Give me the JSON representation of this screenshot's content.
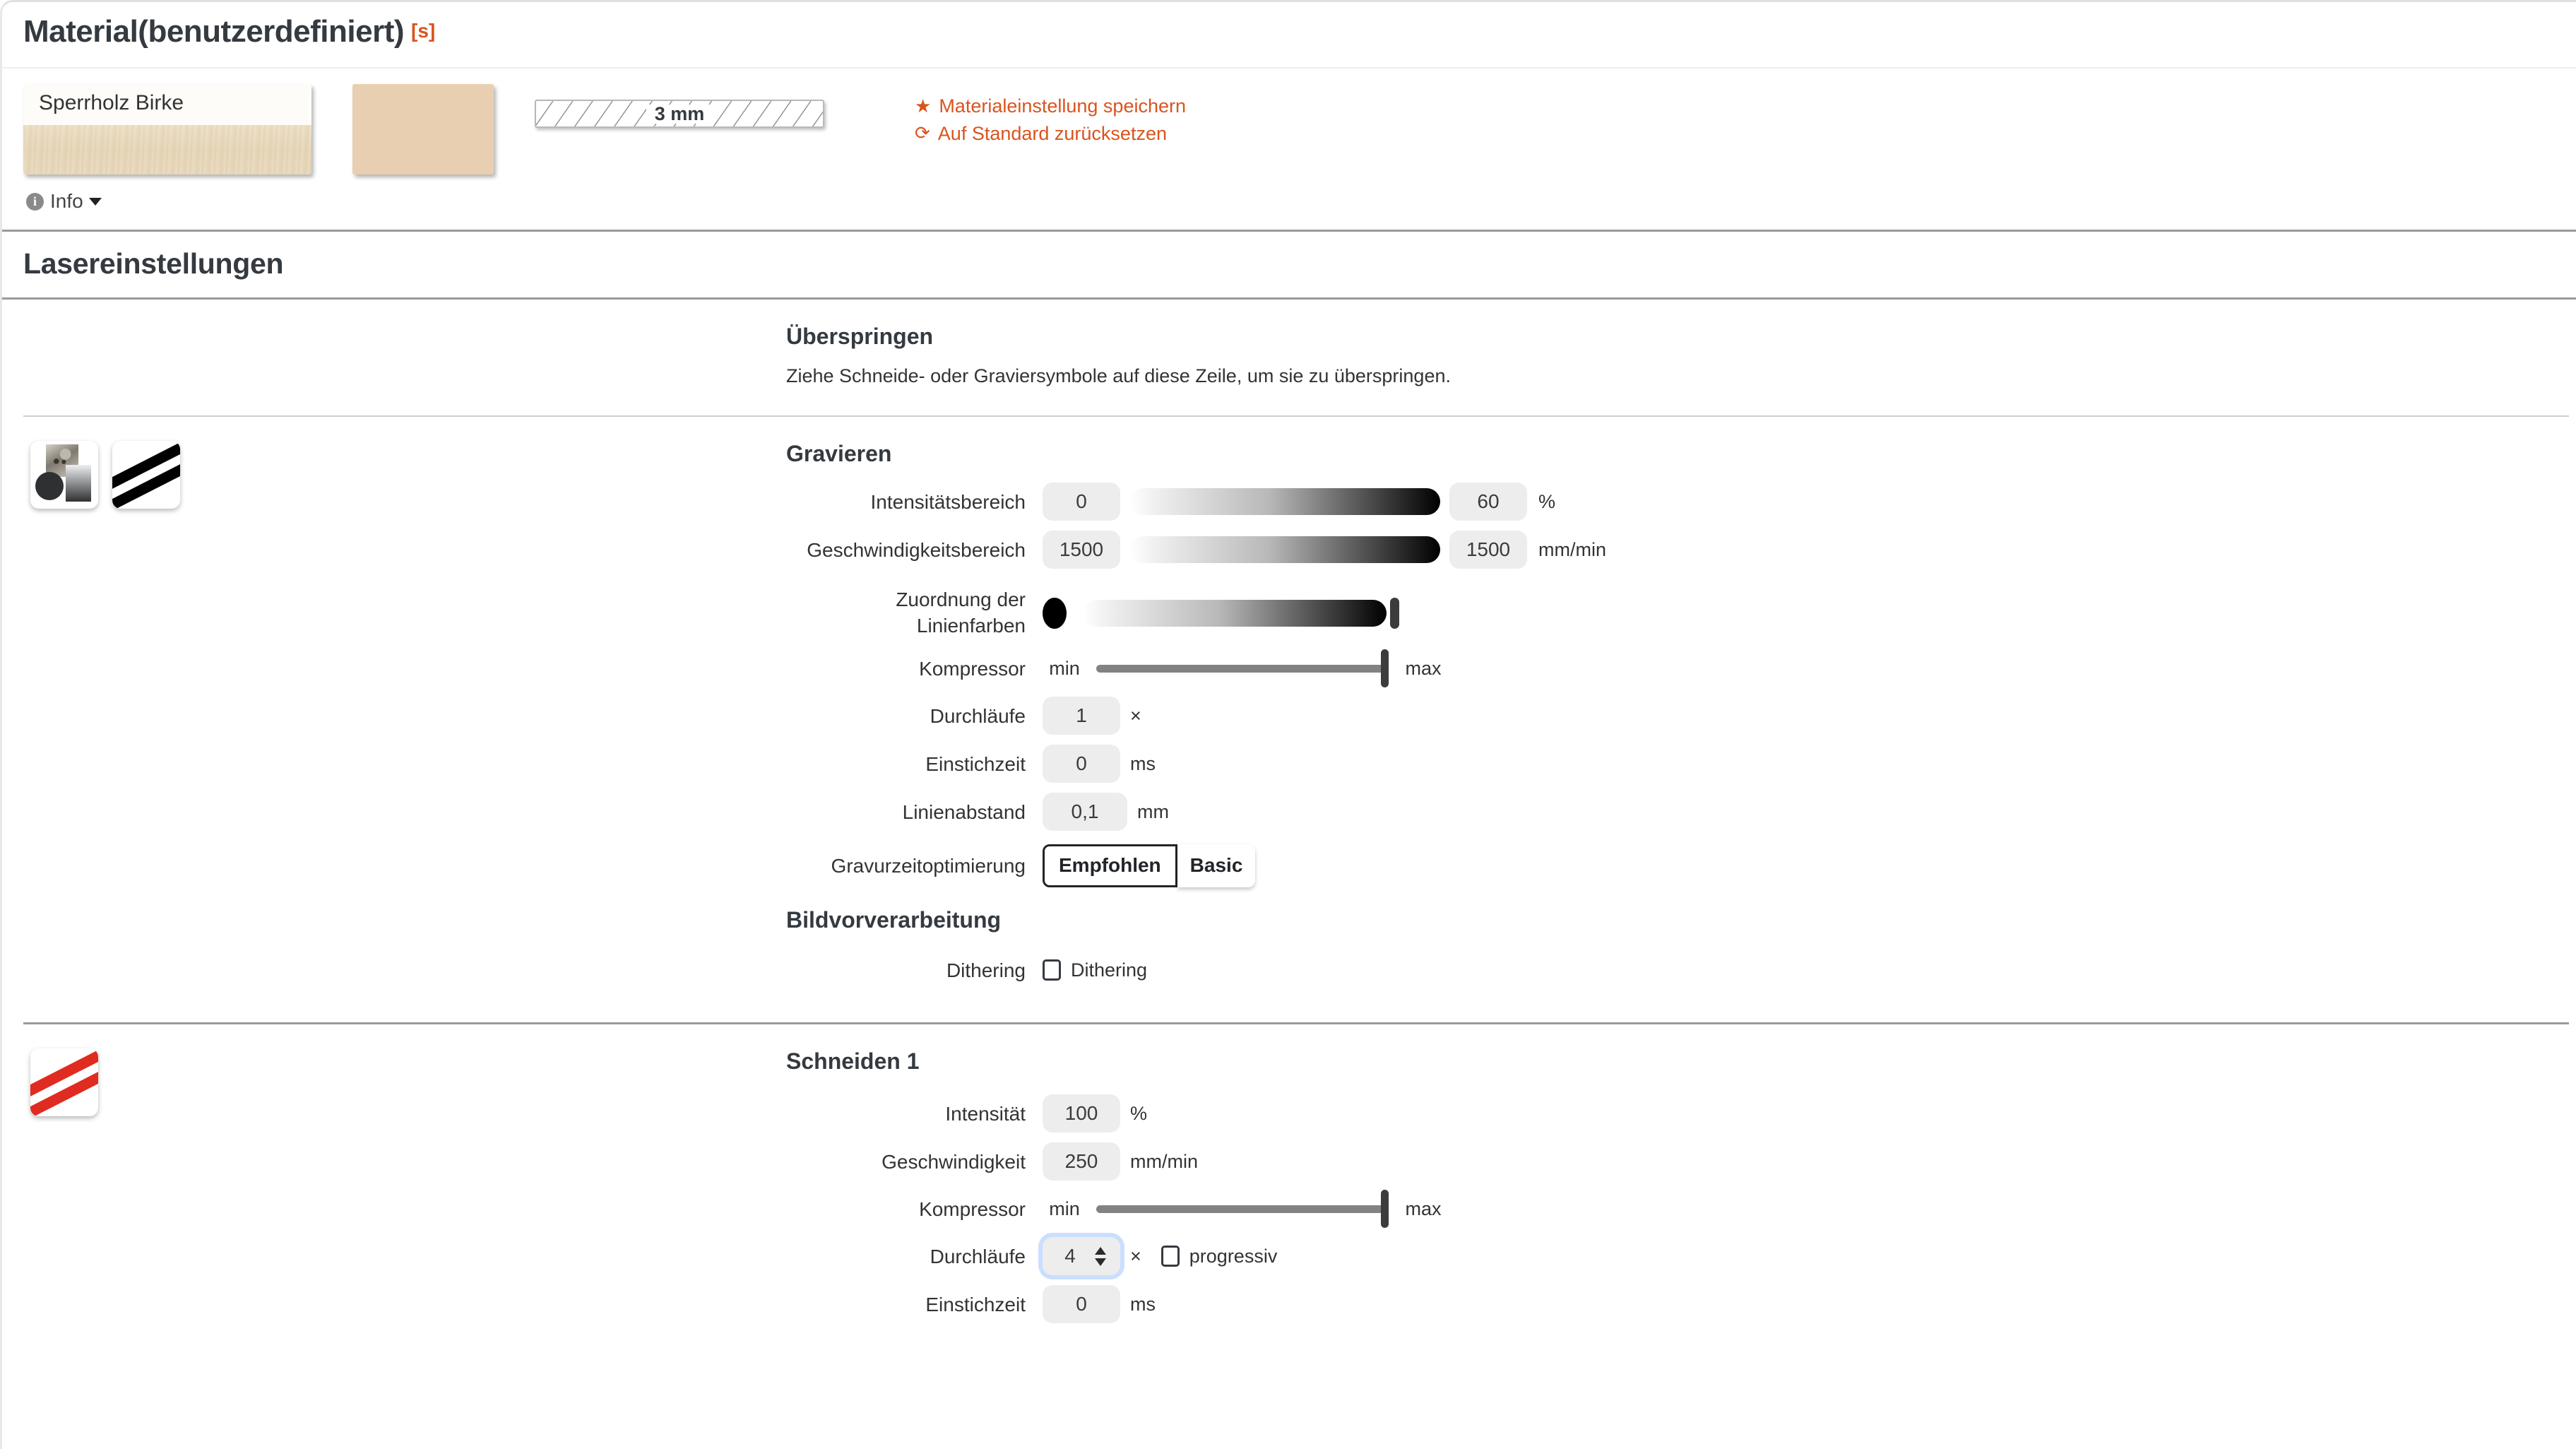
{
  "material": {
    "title": "Material(benutzerdefiniert)",
    "badge": "[s]",
    "card_label": "Sperrholz Birke",
    "thickness": "3 mm",
    "save_label": "Materialeinstellung speichern",
    "save_icon": "star-icon",
    "reset_label": "Auf Standard zurücksetzen",
    "reset_icon": "refresh-icon",
    "info_label": "Info",
    "info_icon": "info-icon"
  },
  "laser": {
    "heading": "Lasereinstellungen"
  },
  "skip": {
    "title": "Überspringen",
    "description": "Ziehe Schneide- oder Graviersymbole auf diese Zeile, um sie zu überspringen."
  },
  "engrave": {
    "title": "Gravieren",
    "icons": [
      {
        "name": "engrave-image-icon"
      },
      {
        "name": "engrave-stripes-icon"
      }
    ],
    "rows": {
      "intensity": {
        "label": "Intensitätsbereich",
        "min_value": "0",
        "max_value": "60",
        "unit": "%"
      },
      "speed": {
        "label": "Geschwindigkeitsbereich",
        "min_value": "1500",
        "max_value": "1500",
        "unit": "mm/min"
      },
      "color_mapping": {
        "label": "Zuordnung der Linienfarben"
      },
      "compressor": {
        "label": "Kompressor",
        "min_label": "min",
        "max_label": "max"
      },
      "passes": {
        "label": "Durchläufe",
        "value": "1",
        "unit": "×"
      },
      "pierce_time": {
        "label": "Einstichzeit",
        "value": "0",
        "unit": "ms"
      },
      "line_spacing": {
        "label": "Linienabstand",
        "value": "0,1",
        "unit": "mm"
      },
      "optimization": {
        "label": "Gravurzeitoptimierung",
        "option_active": "Empfohlen",
        "option_inactive": "Basic"
      }
    },
    "preprocessing": {
      "title": "Bildvorverarbeitung",
      "dithering_label": "Dithering",
      "dithering_checkbox_label": "Dithering",
      "dithering_checked": false
    }
  },
  "cut": {
    "title": "Schneiden 1",
    "icons": [
      {
        "name": "cut-stripes-icon"
      }
    ],
    "rows": {
      "intensity": {
        "label": "Intensität",
        "value": "100",
        "unit": "%"
      },
      "speed": {
        "label": "Geschwindigkeit",
        "value": "250",
        "unit": "mm/min"
      },
      "compressor": {
        "label": "Kompressor",
        "min_label": "min",
        "max_label": "max"
      },
      "passes": {
        "label": "Durchläufe",
        "value": "4",
        "unit": "×",
        "progressive_label": "progressiv",
        "progressive_checked": false
      },
      "pierce_time": {
        "label": "Einstichzeit",
        "value": "0",
        "unit": "ms"
      }
    }
  },
  "colors": {
    "accent": "#d9541e",
    "text": "#333333",
    "heading": "#343a40",
    "cut_stripe": "#e02b20"
  }
}
